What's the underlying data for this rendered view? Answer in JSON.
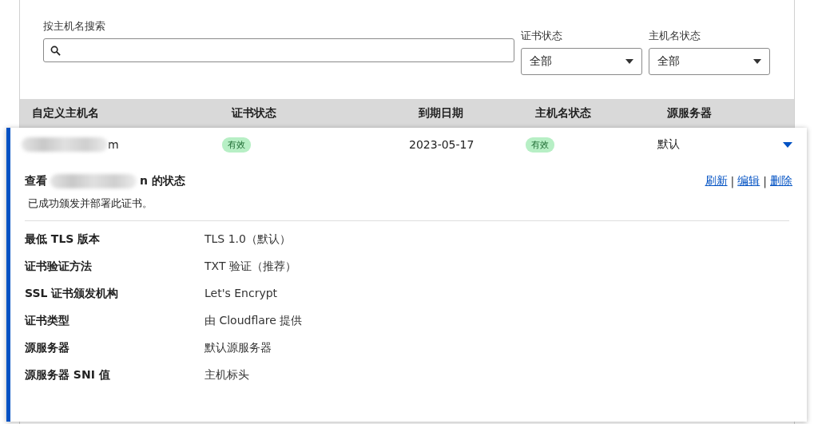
{
  "search": {
    "label": "按主机名搜索"
  },
  "filters": [
    {
      "label": "证书状态",
      "value": "全部"
    },
    {
      "label": "主机名状态",
      "value": "全部"
    }
  ],
  "table": {
    "columns": [
      "自定义主机名",
      "证书状态",
      "到期日期",
      "主机名状态",
      "源服务器"
    ],
    "rows": [
      {
        "hostname": "m",
        "cert_status": "有效",
        "expiry": "2023-05-17",
        "host_status": "有效",
        "origin": "默认",
        "expanded": true,
        "detail": {
          "title_prefix": "查看",
          "title_suffix": "n 的状态",
          "message": "已成功颁发并部署此证书。",
          "actions": [
            "刷新",
            "编辑",
            "删除"
          ],
          "separator": "|",
          "fields": [
            {
              "label": "最低 TLS 版本",
              "value": "TLS 1.0（默认）"
            },
            {
              "label": "证书验证方法",
              "value": "TXT 验证（推荐）"
            },
            {
              "label": "SSL 证书颁发机构",
              "value": "Let's Encrypt"
            },
            {
              "label": "证书类型",
              "value": "由 Cloudflare 提供"
            },
            {
              "label": "源服务器",
              "value": "默认源服务器"
            },
            {
              "label": "源服务器 SNI 值",
              "value": "主机标头"
            }
          ]
        }
      }
    ]
  }
}
